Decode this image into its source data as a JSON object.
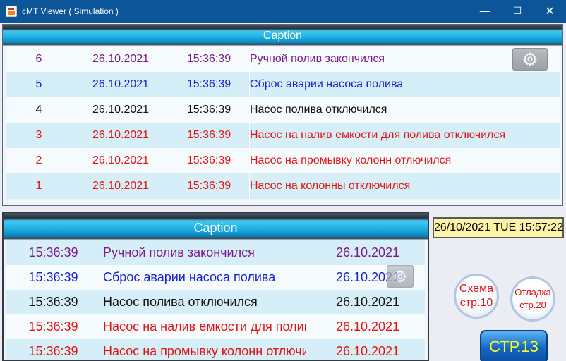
{
  "window": {
    "title": "cMT Viewer ( Simulation )",
    "minimize": "—",
    "maximize": "☐",
    "close": "✕"
  },
  "alarm_table": {
    "caption": "Caption",
    "rows": [
      {
        "no": "6",
        "date": "26.10.2021",
        "time": "15:36:39",
        "message": "Ручной полив закончился",
        "color": "#7a1a8c"
      },
      {
        "no": "5",
        "date": "26.10.2021",
        "time": "15:36:39",
        "message": "Сброс аварии насоса полива",
        "color": "#1622d6"
      },
      {
        "no": "4",
        "date": "26.10.2021",
        "time": "15:36:39",
        "message": "Насос полива отключился",
        "color": "#111111"
      },
      {
        "no": "3",
        "date": "26.10.2021",
        "time": "15:36:39",
        "message": "Насос на налив емкости для полива отключился",
        "color": "#e01414"
      },
      {
        "no": "2",
        "date": "26.10.2021",
        "time": "15:36:39",
        "message": "Насос на промывку колонн отлючился",
        "color": "#e01414"
      },
      {
        "no": "1",
        "date": "26.10.2021",
        "time": "15:36:39",
        "message": "Насос на колонны отключился",
        "color": "#e01414"
      }
    ]
  },
  "event_table": {
    "caption": "Caption",
    "rows": [
      {
        "time": "15:36:39",
        "message": "Ручной полив закончился",
        "date": "26.10.2021",
        "color": "#7a1a8c"
      },
      {
        "time": "15:36:39",
        "message": "Сброс аварии насоса полива",
        "date": "26.10.2021",
        "color": "#1622d6"
      },
      {
        "time": "15:36:39",
        "message": "Насос полива отключился",
        "date": "26.10.2021",
        "color": "#111111"
      },
      {
        "time": "15:36:39",
        "message": "Насос на налив емкости для полива отключился",
        "date": "26.10.2021",
        "color": "#e01414"
      },
      {
        "time": "15:36:39",
        "message": "Насос на промывку колонн отлючился",
        "date": "26.10.2021",
        "color": "#e01414"
      }
    ]
  },
  "clock": {
    "text": "26/10/2021 TUE 15:57:22"
  },
  "buttons": {
    "scheme": {
      "line1": "Схема",
      "line2": "стр.10"
    },
    "debug": {
      "line1": "Отладка",
      "line2": "стр.20"
    },
    "page": {
      "label": "СТР.13"
    }
  },
  "icons": {
    "app": "app-icon",
    "settings": "gear-icon"
  },
  "colors": {
    "accent": "#0c5599",
    "caption": "#1eb2e4",
    "clock_bg": "#fdf4a6",
    "page_button": "#1466c2",
    "page_button_text": "#ffff22"
  }
}
